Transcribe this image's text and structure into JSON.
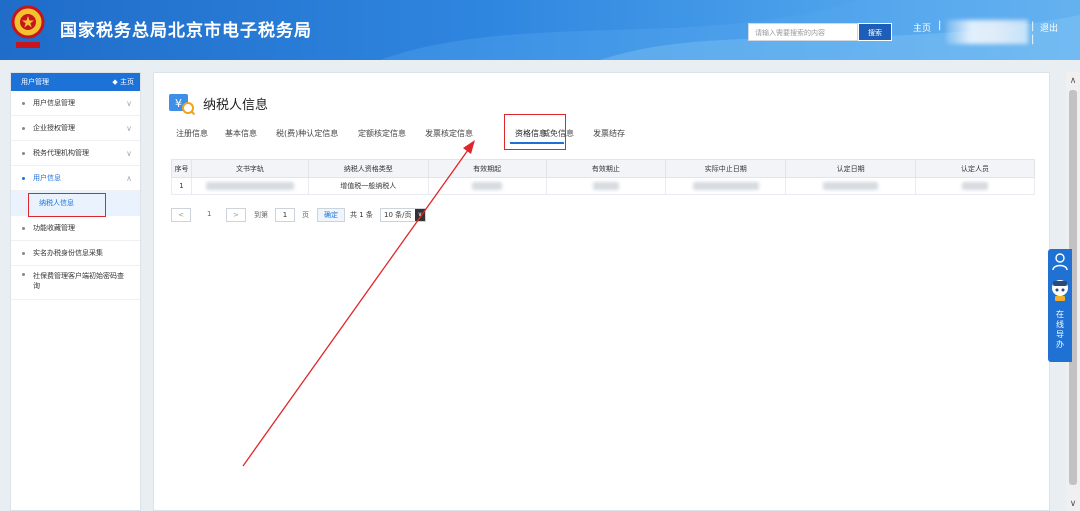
{
  "header": {
    "title": "国家税务总局北京市电子税务局",
    "search_placeholder": "请输入需要搜索的内容",
    "search_button": "搜索",
    "home": "主页",
    "separator": "|",
    "logout": "退出"
  },
  "sidebar": {
    "header_label": "用户管理",
    "header_home": "◆ 主页",
    "items": [
      {
        "label": "用户信息管理",
        "chevron": "∨"
      },
      {
        "label": "企业授权管理",
        "chevron": "∨"
      },
      {
        "label": "税务代理机构管理",
        "chevron": "∨"
      },
      {
        "label": "用户信息",
        "chevron": "∧"
      },
      {
        "label": "功能收藏管理"
      },
      {
        "label": "实名办税身份信息采集"
      },
      {
        "label": "社保费管理客户端初始密码查询"
      }
    ],
    "subitem": "纳税人信息"
  },
  "main": {
    "page_title": "纳税人信息",
    "tabs": [
      "注册信息",
      "基本信息",
      "税(费)种认定信息",
      "定额核定信息",
      "发票核定信息",
      "资格信息",
      "减免信息",
      "发票结存"
    ],
    "table": {
      "headers": [
        "序号",
        "文书字轨",
        "纳税人资格类型",
        "有效期起",
        "有效期止",
        "实际中止日期",
        "认定日期",
        "认定人员"
      ],
      "row": {
        "index": "1",
        "type": "增值税一般纳税人"
      }
    },
    "pager": {
      "prev": "<",
      "current": "1",
      "next": ">",
      "goto": "到第",
      "page_input": "1",
      "page_unit": "页",
      "confirm": "确定",
      "total": "共 1 条",
      "per_page": "10 条/页",
      "dropdown_arrow": "∨"
    }
  },
  "floating": {
    "label": "在线导办"
  },
  "scroll": {
    "up": "∧",
    "down": "∨"
  },
  "colors": {
    "brand_blue": "#1d72d8",
    "highlight_red": "#e0262a"
  }
}
